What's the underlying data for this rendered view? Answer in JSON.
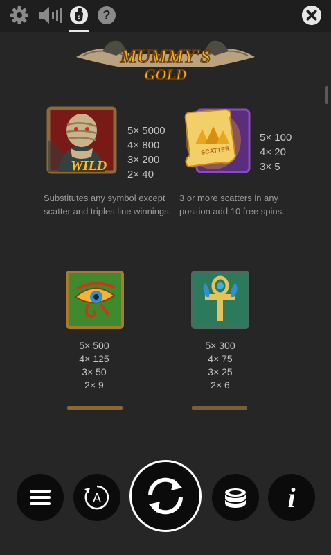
{
  "game": {
    "title": "Mummy's Gold"
  },
  "topbar": {
    "icons": [
      "settings-icon",
      "sound-icon",
      "paytable-icon",
      "help-icon",
      "close-icon"
    ],
    "help_glyph": "?"
  },
  "logo": {
    "line1": "MUMMY'S",
    "line2": "GOLD"
  },
  "symbols": {
    "wild": {
      "badge": "WILD",
      "payouts": [
        "5× 5000",
        "4× 800",
        "3× 200",
        "2× 40"
      ],
      "description": "Substitutes any symbol except scatter and triples line winnings."
    },
    "scatter": {
      "badge": "SCATTER",
      "payouts": [
        "5× 100",
        "4× 20",
        "3× 5"
      ],
      "description": "3 or more scatters in any position add 10 free spins."
    },
    "eye": {
      "payouts": [
        "5× 500",
        "4× 125",
        "3× 50",
        "2× 9"
      ]
    },
    "ankh": {
      "payouts": [
        "5× 300",
        "4× 75",
        "3× 25",
        "2× 6"
      ]
    }
  },
  "bottombar": {
    "buttons": [
      "menu-button",
      "autoplay-button",
      "spin-button",
      "bet-button",
      "info-button"
    ],
    "autoplay_letter": "A",
    "info_glyph": "i"
  },
  "colors": {
    "background": "#262626",
    "topbar": "#1e1e1e",
    "button": "#0b0b0b",
    "gold": "#f2b21c"
  }
}
